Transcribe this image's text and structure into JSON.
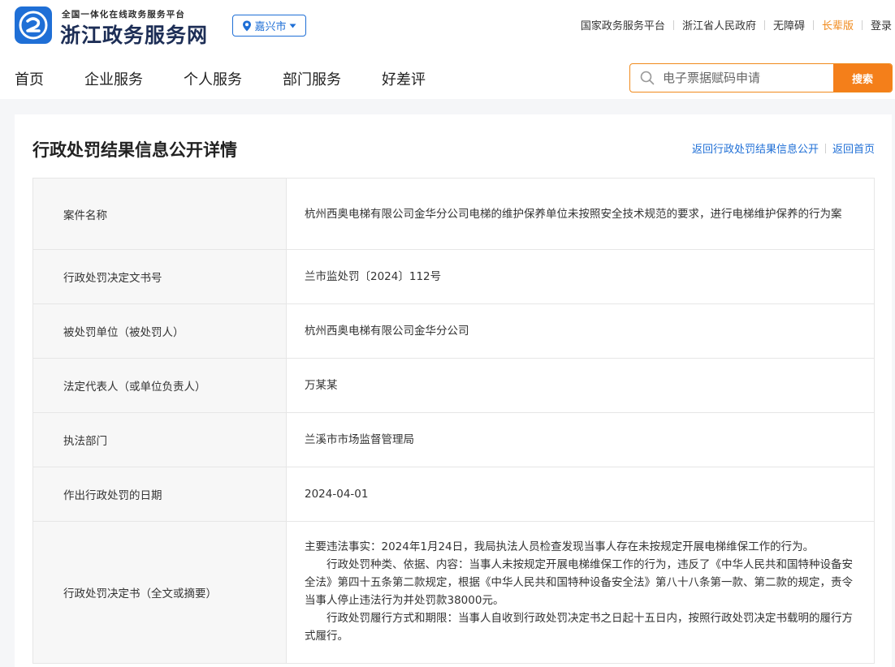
{
  "header": {
    "logo_subtitle": "全国一体化在线政务服务平台",
    "logo_title": "浙江政务服务网",
    "city": "嘉兴市",
    "top_links": [
      "国家政务服务平台",
      "浙江省人民政府",
      "无障碍",
      "长辈版",
      "登录"
    ]
  },
  "nav": {
    "items": [
      "首页",
      "企业服务",
      "个人服务",
      "部门服务",
      "好差评"
    ]
  },
  "search": {
    "placeholder": "电子票据赋码申请",
    "button_label": "搜索"
  },
  "page": {
    "title": "行政处罚结果信息公开详情",
    "back_list_link": "返回行政处罚结果信息公开",
    "back_home_link": "返回首页"
  },
  "details": [
    {
      "label": "案件名称",
      "value": "杭州西奥电梯有限公司金华分公司电梯的维护保养单位未按照安全技术规范的要求，进行电梯维护保养的行为案"
    },
    {
      "label": "行政处罚决定文书号",
      "value": "兰市监处罚〔2024〕112号"
    },
    {
      "label": "被处罚单位（被处罚人）",
      "value": "杭州西奥电梯有限公司金华分公司"
    },
    {
      "label": "法定代表人（或单位负责人）",
      "value": "万某某"
    },
    {
      "label": "执法部门",
      "value": "兰溪市市场监督管理局"
    },
    {
      "label": "作出行政处罚的日期",
      "value": "2024-04-01"
    },
    {
      "label": "行政处罚决定书（全文或摘要）",
      "paragraphs": [
        "主要违法事实：2024年1月24日，我局执法人员检查发现当事人存在未按规定开展电梯维保工作的行为。",
        "行政处罚种类、依据、内容：当事人未按规定开展电梯维保工作的行为，违反了《中华人民共和国特种设备安全法》第四十五条第二款规定，根据《中华人民共和国特种设备安全法》第八十八条第一款、第二款的规定，责令当事人停止违法行为并处罚款38000元。",
        "行政处罚履行方式和期限：当事人自收到行政处罚决定书之日起十五日内，按照行政处罚决定书载明的履行方式履行。"
      ]
    }
  ],
  "colors": {
    "brand_blue": "#1f6fd6",
    "accent_orange": "#f47f1a",
    "elder_link": "#f08a1c"
  }
}
